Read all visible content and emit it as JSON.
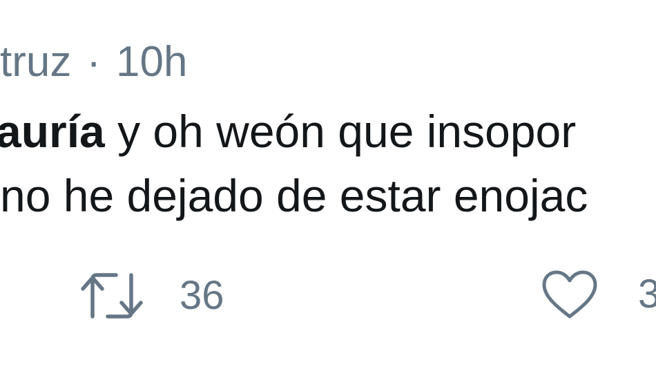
{
  "tweet": {
    "author_fragment": "truz",
    "separator": "·",
    "time": "10h",
    "line1_mention": "auría",
    "line1_text": " y oh weón que insopor",
    "line2_text": "no he dejado de estar enojac",
    "actions": {
      "retweet_icon": "retweet-icon",
      "retweet_count": "36",
      "like_icon": "heart-icon",
      "like_count": "3"
    }
  },
  "colors": {
    "text": "#14171a",
    "muted": "#657786",
    "background": "#ffffff"
  }
}
